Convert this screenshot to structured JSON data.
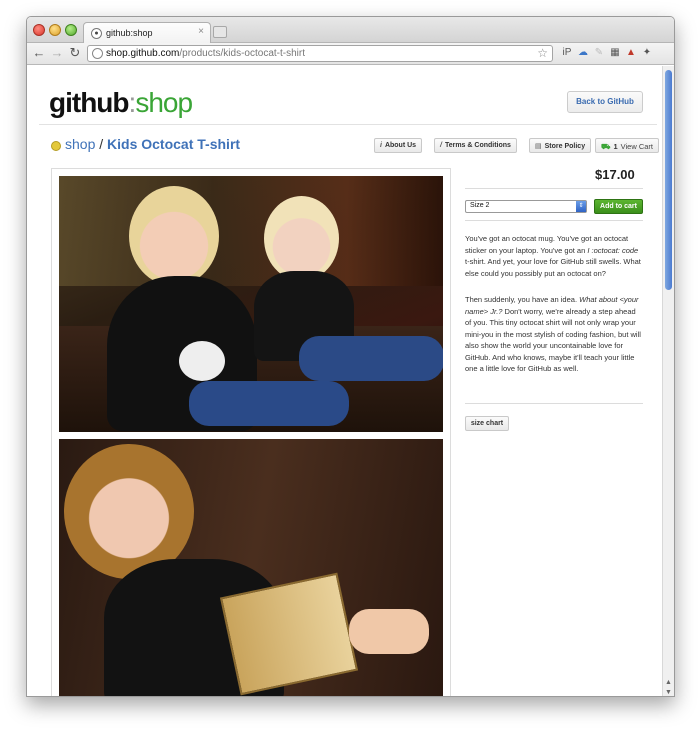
{
  "browser": {
    "tab_title": "github:shop",
    "tab_close": "×",
    "url_host": "shop.github.com",
    "url_path": "/products/kids-octocat-t-shirt"
  },
  "header": {
    "logo_github": "github",
    "logo_sep": ":",
    "logo_shop": "shop",
    "back_button": "Back to GitHub"
  },
  "breadcrumb": {
    "shop": "shop",
    "separator": " / ",
    "title": "Kids Octocat T-shirt"
  },
  "nav": {
    "about": "About Us",
    "terms": "Terms & Conditions",
    "policy": "Store Policy",
    "cart_count": "1",
    "cart_view": "View Cart"
  },
  "product": {
    "price": "$17.00",
    "size_selected": "Size 2",
    "add_to_cart": "Add to cart",
    "desc1_a": "You've got an octocat mug. You've got an octocat sticker on your laptop. You've got an ",
    "desc1_em": "I :octocat: code",
    "desc1_b": " t-shirt. And yet, your love for GitHub still swells. What else could you possibly put an octocat on?",
    "desc2_a": "Then suddenly, you have an idea. ",
    "desc2_em": "What about <your name> Jr.?",
    "desc2_b": " Don't worry, we're already a step ahead of you. This tiny octocat shirt will not only wrap your mini-you in the most stylish of coding fashion, but will also show the world your uncontainable love for GitHub. And who knows, maybe it'll teach your little one a little love for GitHub as well.",
    "size_chart": "size chart"
  },
  "colors": {
    "link_blue": "#3f72b8",
    "brand_green": "#3aa536",
    "button_green": "#4aa326"
  }
}
